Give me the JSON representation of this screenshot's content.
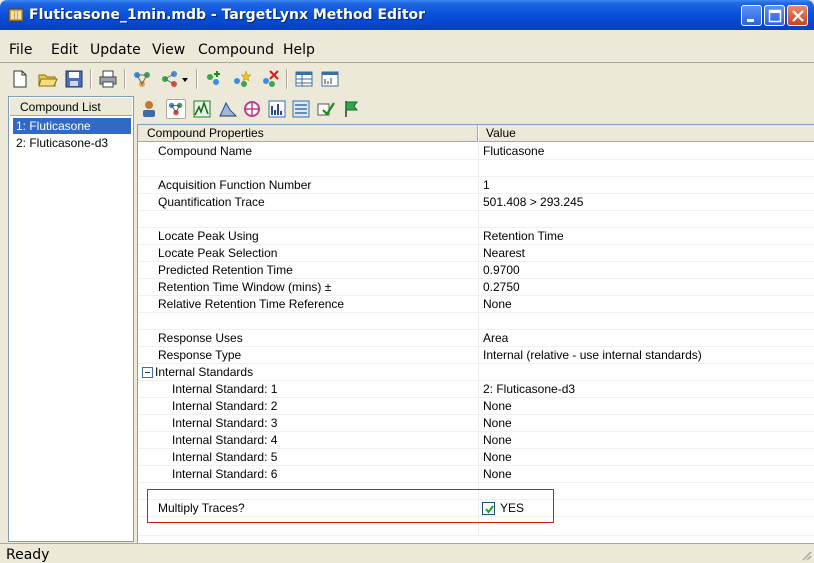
{
  "window": {
    "title": "Fluticasone_1min.mdb - TargetLynx Method Editor"
  },
  "menu": {
    "items": [
      "File",
      "Edit",
      "Update",
      "View",
      "Compound",
      "Help"
    ]
  },
  "toolbar": {
    "icons": [
      "new-file-icon",
      "open-folder-icon",
      "save-icon",
      "print-icon",
      "molecule-icon",
      "molecule-dropdown-icon",
      "chevron-down-icon",
      "add-compound-icon",
      "compound-star-icon",
      "delete-compound-icon",
      "table-view-icon",
      "chart-view-icon"
    ]
  },
  "compound_list": {
    "header": "Compound List",
    "items": [
      "1: Fluticasone",
      "2: Fluticasone-d3"
    ],
    "selected_index": 0
  },
  "property_icons": [
    "compound-person-icon",
    "compound-properties-icon",
    "chromatogram-icon",
    "peak-icon",
    "target-icon",
    "spectrum-icon",
    "calibration-icon",
    "check-icon",
    "flag-icon"
  ],
  "grid": {
    "header_property": "Compound Properties",
    "header_value": "Value",
    "rows": [
      {
        "property": "Compound Name",
        "value": "Fluticasone"
      },
      {
        "property": "",
        "value": ""
      },
      {
        "property": "Acquisition Function Number",
        "value": "1"
      },
      {
        "property": "Quantification Trace",
        "value": "501.408 > 293.245"
      },
      {
        "property": "",
        "value": ""
      },
      {
        "property": "Locate Peak Using",
        "value": "Retention Time"
      },
      {
        "property": "Locate Peak Selection",
        "value": "Nearest"
      },
      {
        "property": "Predicted Retention Time",
        "value": "0.9700"
      },
      {
        "property": "Retention Time Window (mins) ±",
        "value": "0.2750"
      },
      {
        "property": "Relative Retention Time Reference",
        "value": "None"
      },
      {
        "property": "",
        "value": ""
      },
      {
        "property": "Response Uses",
        "value": "Area"
      },
      {
        "property": "Response Type",
        "value": "Internal (relative - use internal standards)"
      },
      {
        "property": "Internal Standards",
        "value": ""
      },
      {
        "property": "Internal Standard: 1",
        "value": "2: Fluticasone-d3"
      },
      {
        "property": "Internal Standard: 2",
        "value": "None"
      },
      {
        "property": "Internal Standard: 3",
        "value": "None"
      },
      {
        "property": "Internal Standard: 4",
        "value": "None"
      },
      {
        "property": "Internal Standard: 5",
        "value": "None"
      },
      {
        "property": "Internal Standard: 6",
        "value": "None"
      }
    ],
    "multiply_traces": {
      "property": "Multiply Traces?",
      "value": "YES",
      "checked": true
    }
  },
  "status": {
    "text": "Ready"
  }
}
